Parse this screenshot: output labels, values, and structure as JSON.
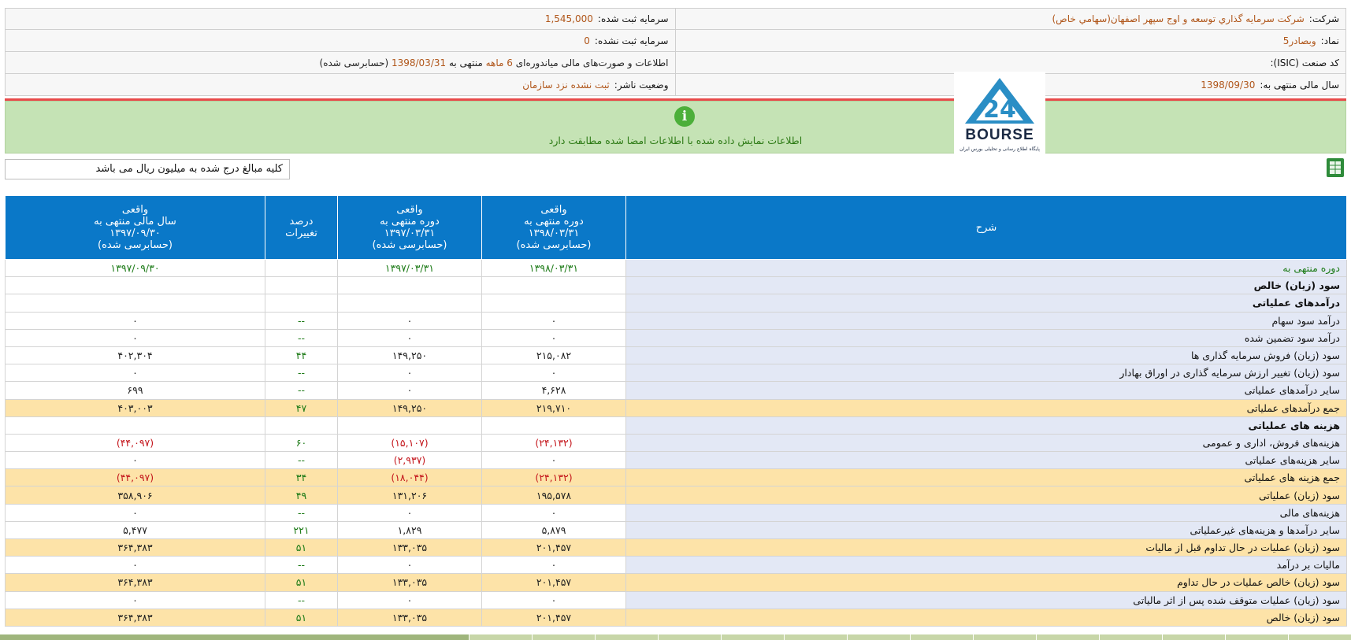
{
  "company": {
    "company_label": "شرکت:",
    "company_value": "شرکت سرمايه گذاري توسعه و اوج سپهر اصفهان(سهامي خاص)",
    "registered_capital_label": "سرمایه ثبت شده:",
    "registered_capital_value": "1,545,000",
    "symbol_label": "نماد:",
    "symbol_value": "وبصادر5",
    "unregistered_capital_label": "سرمایه ثبت نشده:",
    "unregistered_capital_value": "0",
    "isic_label": "کد صنعت (ISIC):",
    "isic_value": "",
    "statement_prefix": "اطلاعات و صورت‌های مالی میاندوره‌ای",
    "statement_period": "6 ماهه",
    "statement_mid": "منتهی به",
    "statement_date": "1398/03/31",
    "statement_suffix": "(حسابرسی شده)",
    "fiscal_year_label": "سال مالی منتهی به:",
    "fiscal_year_value": "1398/09/30",
    "publisher_status_label": "وضعیت ناشر:",
    "publisher_status_value": "ثبت نشده نزد سازمان"
  },
  "notice": {
    "icon": "info-icon",
    "text": "اطلاعات نمایش داده شده با اطلاعات امضا شده مطابقت دارد"
  },
  "logo": {
    "number": "24",
    "word": "BOURSE",
    "tagline": "پایگاه اطلاع رسانی و تحلیلی بورس ایران"
  },
  "amount_note": "کلیه مبالغ درج شده به میلیون ریال می باشد",
  "table": {
    "headers": {
      "desc": "شرح",
      "col1": [
        "واقعی",
        "دوره منتهی به",
        "۱۳۹۸/۰۳/۳۱",
        "(حسابرسی شده)"
      ],
      "col2": [
        "واقعی",
        "دوره منتهی به",
        "۱۳۹۷/۰۳/۳۱",
        "(حسابرسی شده)"
      ],
      "col3": [
        "درصد",
        "تغییرات"
      ],
      "col4": [
        "واقعی",
        "سال مالی منتهی به",
        "۱۳۹۷/۰۹/۳۰",
        "(حسابرسی شده)"
      ]
    },
    "rows": [
      {
        "desc": "دوره منتهی به",
        "c1": "۱۳۹۸/۰۳/۳۱",
        "c2": "۱۳۹۷/۰۳/۳۱",
        "c3": "",
        "c4": "۱۳۹۷/۰۹/۳۰",
        "type": "date"
      },
      {
        "desc": "سود (زیان) خالص",
        "c1": "",
        "c2": "",
        "c3": "",
        "c4": "",
        "type": "sec"
      },
      {
        "desc": "درآمدهای عملیاتی",
        "c1": "",
        "c2": "",
        "c3": "",
        "c4": "",
        "type": "sec"
      },
      {
        "desc": "درآمد سود سهام",
        "c1": "۰",
        "c2": "۰",
        "c3": "--",
        "c4": "۰",
        "type": "row"
      },
      {
        "desc": "درآمد سود تضمین شده",
        "c1": "۰",
        "c2": "۰",
        "c3": "--",
        "c4": "۰",
        "type": "row"
      },
      {
        "desc": "سود (زیان) فروش سرمایه گذاری ها",
        "c1": "۲۱۵,۰۸۲",
        "c2": "۱۴۹,۲۵۰",
        "c3": "۴۴",
        "c4": "۴۰۲,۳۰۴",
        "type": "row"
      },
      {
        "desc": "سود (زیان) تغییر ارزش سرمایه گذاری در اوراق بهادار",
        "c1": "۰",
        "c2": "۰",
        "c3": "--",
        "c4": "۰",
        "type": "row"
      },
      {
        "desc": "سایر درآمدهای عملیاتی",
        "c1": "۴,۶۲۸",
        "c2": "۰",
        "c3": "--",
        "c4": "۶۹۹",
        "type": "row"
      },
      {
        "desc": "جمع درآمدهای عملیاتی",
        "c1": "۲۱۹,۷۱۰",
        "c2": "۱۴۹,۲۵۰",
        "c3": "۴۷",
        "c4": "۴۰۳,۰۰۳",
        "type": "hi"
      },
      {
        "desc": "هزینه های عملیاتی",
        "c1": "",
        "c2": "",
        "c3": "",
        "c4": "",
        "type": "sec"
      },
      {
        "desc": "هزینه‌های فروش، اداری و عمومی",
        "c1": "(۲۴,۱۳۲)",
        "c2": "(۱۵,۱۰۷)",
        "c3": "۶۰",
        "c4": "(۴۴,۰۹۷)",
        "type": "row"
      },
      {
        "desc": "سایر هزینه‌های عملیاتی",
        "c1": "۰",
        "c2": "(۲,۹۳۷)",
        "c3": "--",
        "c4": "۰",
        "type": "row"
      },
      {
        "desc": "جمع هزینه های عملیاتی",
        "c1": "(۲۴,۱۳۲)",
        "c2": "(۱۸,۰۴۴)",
        "c3": "۳۴",
        "c4": "(۴۴,۰۹۷)",
        "type": "hi"
      },
      {
        "desc": "سود (زیان) عملیاتی",
        "c1": "۱۹۵,۵۷۸",
        "c2": "۱۳۱,۲۰۶",
        "c3": "۴۹",
        "c4": "۳۵۸,۹۰۶",
        "type": "hi"
      },
      {
        "desc": "هزینه‌های مالی",
        "c1": "۰",
        "c2": "۰",
        "c3": "--",
        "c4": "۰",
        "type": "row"
      },
      {
        "desc": "سایر درآمدها و هزینه‌های غیرعملیاتی",
        "c1": "۵,۸۷۹",
        "c2": "۱,۸۲۹",
        "c3": "۲۲۱",
        "c4": "۵,۴۷۷",
        "type": "row"
      },
      {
        "desc": "سود (زیان) عملیات در حال تداوم قبل از مالیات",
        "c1": "۲۰۱,۴۵۷",
        "c2": "۱۳۳,۰۳۵",
        "c3": "۵۱",
        "c4": "۳۶۴,۳۸۳",
        "type": "hi"
      },
      {
        "desc": "مالیات بر درآمد",
        "c1": "۰",
        "c2": "۰",
        "c3": "--",
        "c4": "۰",
        "type": "row"
      },
      {
        "desc": "سود (زیان) خالص عملیات در حال تداوم",
        "c1": "۲۰۱,۴۵۷",
        "c2": "۱۳۳,۰۳۵",
        "c3": "۵۱",
        "c4": "۳۶۴,۳۸۳",
        "type": "hi"
      },
      {
        "desc": "سود (زیان) عملیات متوقف شده پس از اثر مالیاتی",
        "c1": "۰",
        "c2": "۰",
        "c3": "--",
        "c4": "۰",
        "type": "row"
      },
      {
        "desc": "سود (زیان) خالص",
        "c1": "۲۰۱,۴۵۷",
        "c2": "۱۳۳,۰۳۵",
        "c3": "۵۱",
        "c4": "۳۶۴,۳۸۳",
        "type": "hi"
      }
    ]
  },
  "colors": {
    "header_blue": "#0a78c8",
    "highlight_row": "#fde3a8",
    "desc_bg": "#e3e8f5",
    "negative": "#c4171d",
    "positive_green": "#1c7a16",
    "notice_bg": "#c5e3b5",
    "accent_orange": "#b0561a"
  }
}
